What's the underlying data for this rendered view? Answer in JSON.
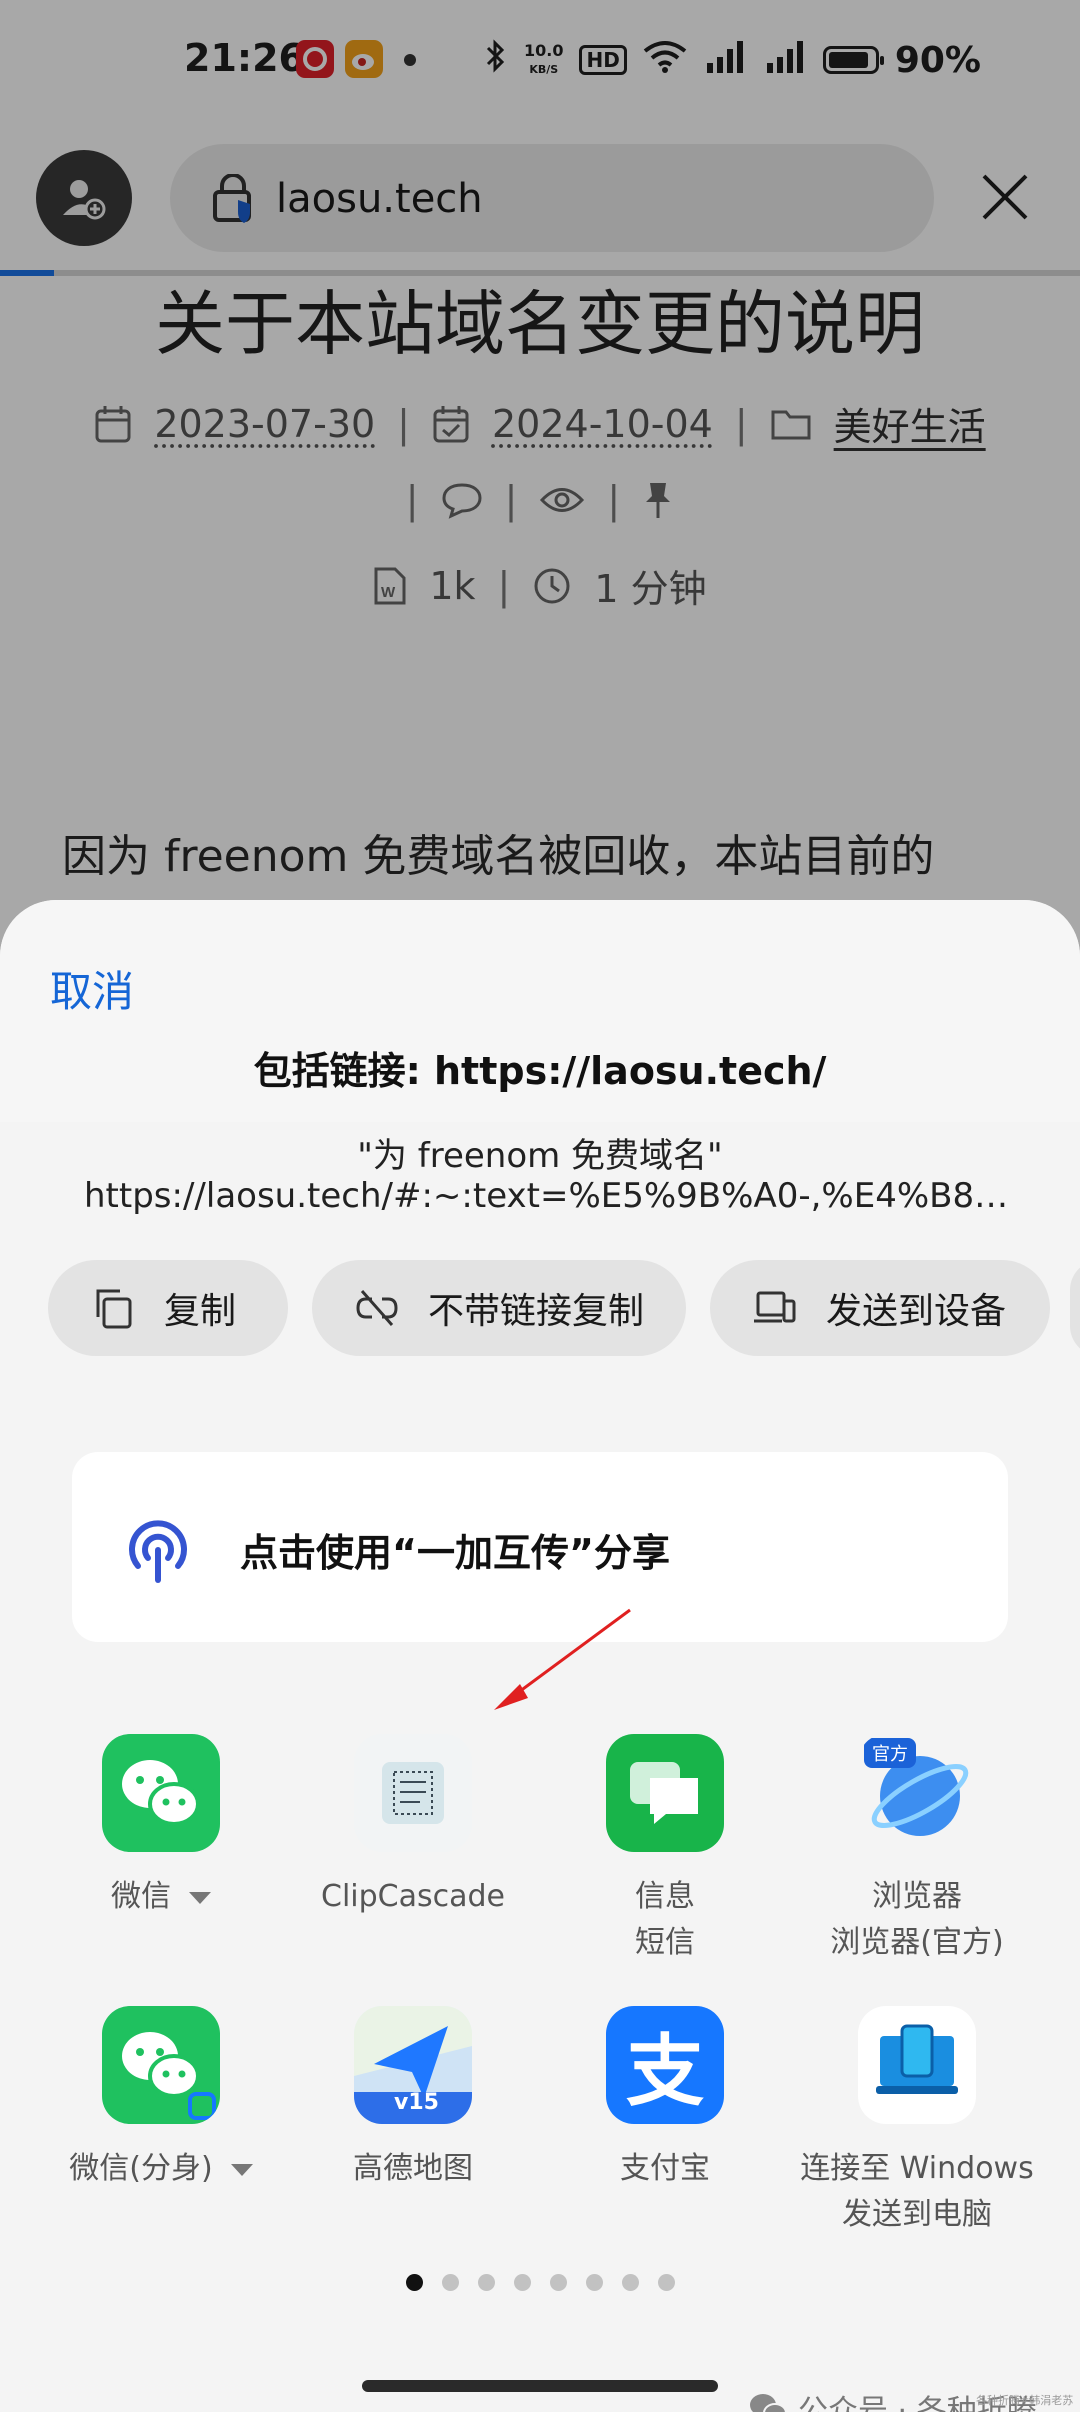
{
  "status_bar": {
    "time": "21:26",
    "speed_value": "10.0",
    "speed_unit": "KB/S",
    "hd_badge": "HD",
    "battery_percent": "90%",
    "battery_level": 0.9
  },
  "browser": {
    "url": "laosu.tech",
    "load_progress": 0.05
  },
  "article": {
    "title": "关于本站域名变更的说明",
    "published": "2023-07-30",
    "updated": "2024-10-04",
    "category": "美好生活",
    "word_count": "1k",
    "read_time": "1 分钟",
    "separator": "|",
    "body_start": "因为 freenom 免费域名被回收，本站目前的"
  },
  "share_sheet": {
    "cancel_label": "取消",
    "link_line": "包括链接: https://laosu.tech/",
    "quote_text": "\"为 freenom 免费域名\"",
    "quote_url": "https://laosu.tech/#:~:text=%E5%9B%A0-,%E4%B8%BA%...",
    "actions": [
      {
        "label": "复制"
      },
      {
        "label": "不带链接复制"
      },
      {
        "label": "发送到设备"
      }
    ],
    "handoff_label": "点击使用“一加互传”分享",
    "apps": [
      {
        "name": "微信",
        "sub": ""
      },
      {
        "name": "ClipCascade",
        "sub": ""
      },
      {
        "name": "信息",
        "sub": "短信"
      },
      {
        "name": "浏览器",
        "sub": "浏览器(官方)",
        "badge": "官方"
      },
      {
        "name": "微信(分身)",
        "sub": ""
      },
      {
        "name": "高德地图",
        "sub": "",
        "badge": "v15"
      },
      {
        "name": "支付宝",
        "sub": "",
        "glyph": "支"
      },
      {
        "name": "连接至 Windows",
        "sub": "发送到电脑"
      }
    ],
    "page_count": 8,
    "active_page": 0
  },
  "watermark": {
    "text": "公众号 · 各种折腾",
    "small": "各种折腾#韩涓老苏"
  },
  "colors": {
    "accent_blue": "#1566d6",
    "wechat_green": "#1fc15f",
    "alipay_blue": "#1677ff",
    "progress_blue": "#1a73e8"
  }
}
